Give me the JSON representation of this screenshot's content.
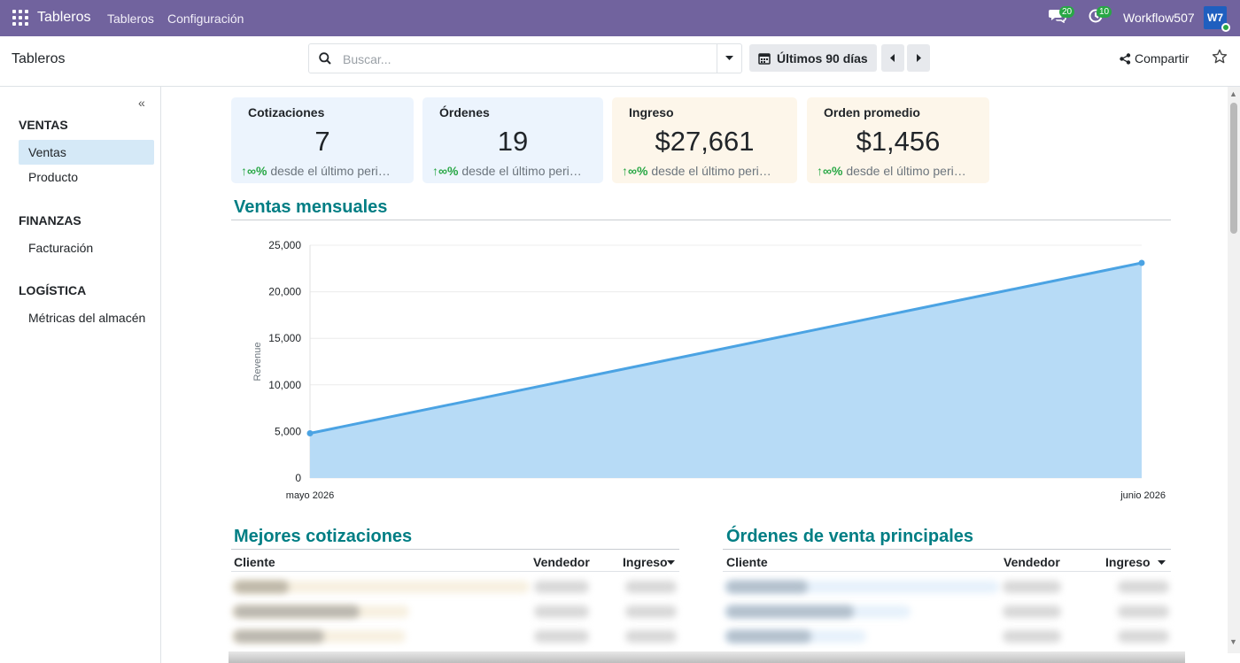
{
  "topbar": {
    "app_name": "Tableros",
    "menus": [
      "Tableros",
      "Configuración"
    ],
    "messages_count": "20",
    "activities_count": "10",
    "user_name": "Workflow507",
    "avatar_initials": "W7",
    "bg_color": "#71639e"
  },
  "control_panel": {
    "title": "Tableros",
    "search_placeholder": "Buscar...",
    "date_filter": "Últimos 90 días",
    "share_label": "Compartir"
  },
  "sidebar": {
    "groups": [
      {
        "label": "VENTAS",
        "items": [
          "Ventas",
          "Producto"
        ]
      },
      {
        "label": "FINANZAS",
        "items": [
          "Facturación"
        ]
      },
      {
        "label": "LOGÍSTICA",
        "items": [
          "Métricas del almacén"
        ]
      }
    ],
    "active_item": "Ventas"
  },
  "kpis": [
    {
      "title": "Cotizaciones",
      "value": "7",
      "trend": "∞%",
      "trend_text": "desde el último peri…"
    },
    {
      "title": "Órdenes",
      "value": "19",
      "trend": "∞%",
      "trend_text": "desde el último peri…"
    },
    {
      "title": "Ingreso",
      "value": "$27,661",
      "trend": "∞%",
      "trend_text": "desde el último peri…"
    },
    {
      "title": "Orden promedio",
      "value": "$1,456",
      "trend": "∞%",
      "trend_text": "desde el último peri…"
    }
  ],
  "sections": {
    "monthly_sales": "Ventas mensuales",
    "top_quotes": "Mejores cotizaciones",
    "top_orders": "Órdenes de venta principales"
  },
  "chart_data": {
    "type": "area",
    "categories": [
      "mayo 2026",
      "junio 2026"
    ],
    "values": [
      4800,
      23100
    ],
    "ylabel": "Revenue",
    "xlabel": "",
    "ylim": [
      0,
      25000
    ],
    "yticks": [
      "0",
      "5,000",
      "10,000",
      "15,000",
      "20,000",
      "25,000"
    ],
    "grid": true,
    "line_color": "#4ba3e3",
    "fill_color": "#b7dbf6"
  },
  "tables": {
    "quotes": {
      "columns": [
        "Cliente",
        "Vendedor",
        "Ingreso"
      ]
    },
    "orders": {
      "columns": [
        "Cliente",
        "Vendedor",
        "Ingreso"
      ]
    }
  }
}
